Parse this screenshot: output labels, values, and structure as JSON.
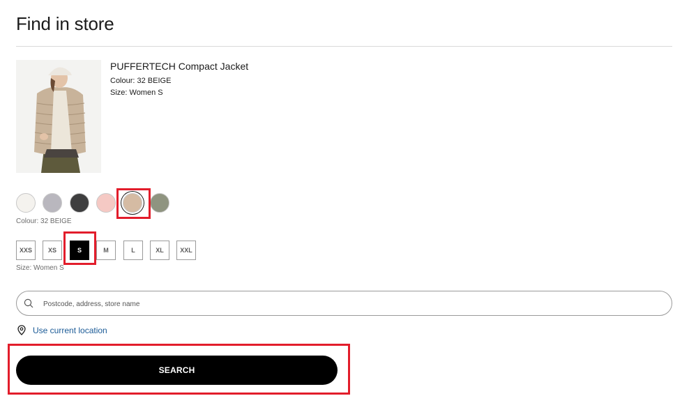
{
  "page": {
    "title": "Find in store"
  },
  "product": {
    "name": "PUFFERTECH Compact Jacket",
    "colour_line": "Colour: 32 BEIGE",
    "size_line": "Size: Women S"
  },
  "colours": {
    "caption": "Colour: 32 BEIGE",
    "selected": "beige",
    "options": [
      {
        "name": "off-white",
        "hex": "#f4f2ee"
      },
      {
        "name": "light-grey",
        "hex": "#b9b7be"
      },
      {
        "name": "dark-grey",
        "hex": "#3e3e3f"
      },
      {
        "name": "pink",
        "hex": "#f5c9c4"
      },
      {
        "name": "beige",
        "hex": "#d5bba3"
      },
      {
        "name": "olive",
        "hex": "#8f9480"
      }
    ]
  },
  "sizes": {
    "caption": "Size: Women S",
    "selected": "S",
    "options": [
      "XXS",
      "XS",
      "S",
      "M",
      "L",
      "XL",
      "XXL"
    ]
  },
  "search": {
    "placeholder": "Postcode, address, store name",
    "value": "",
    "use_location_label": "Use current location",
    "button_label": "SEARCH"
  },
  "colors": {
    "highlight": "#e21d2b",
    "link": "#1a5a96",
    "primary_button": "#000000"
  }
}
